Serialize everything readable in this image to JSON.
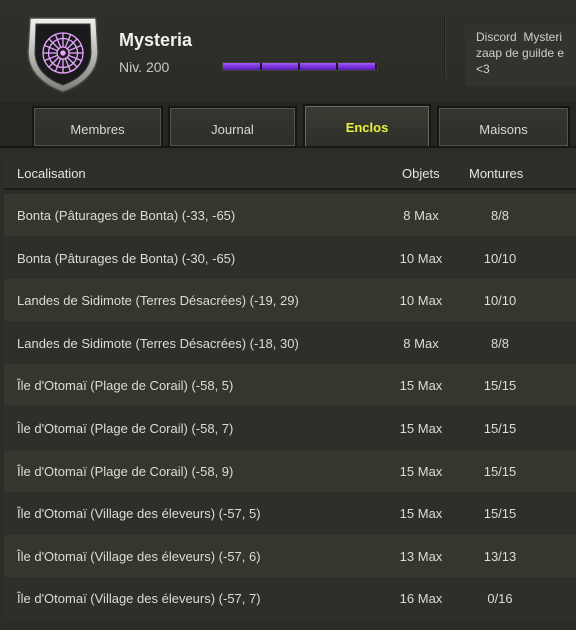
{
  "guild": {
    "name": "Mysteria",
    "level": "Niv. 200",
    "xp_progress": 0.985,
    "emblem_icon": "rose-compass-emblem-icon",
    "emblem_color": "#e8a6ff",
    "message": "Discord  Mysteri\nzaap de guilde e\n<3"
  },
  "tabs": [
    {
      "label": "Membres",
      "active": false
    },
    {
      "label": "Journal",
      "active": false
    },
    {
      "label": "Enclos",
      "active": true
    },
    {
      "label": "Maisons",
      "active": false
    }
  ],
  "table": {
    "headers": {
      "location": "Localisation",
      "objects": "Objets",
      "mounts": "Montures"
    },
    "rows": [
      {
        "location": "Bonta (Pâturages de Bonta) (-33, -65)",
        "objects": "8 Max",
        "mounts": "8/8"
      },
      {
        "location": "Bonta (Pâturages de Bonta) (-30, -65)",
        "objects": "10 Max",
        "mounts": "10/10"
      },
      {
        "location": "Landes de Sidimote (Terres Désacrées) (-19, 29)",
        "objects": "10 Max",
        "mounts": "10/10"
      },
      {
        "location": "Landes de Sidimote (Terres Désacrées) (-18, 30)",
        "objects": "8 Max",
        "mounts": "8/8"
      },
      {
        "location": "Île d'Otomaï (Plage de Corail) (-58, 5)",
        "objects": "15 Max",
        "mounts": "15/15"
      },
      {
        "location": "Île d'Otomaï (Plage de Corail) (-58, 7)",
        "objects": "15 Max",
        "mounts": "15/15"
      },
      {
        "location": "Île d'Otomaï (Plage de Corail) (-58, 9)",
        "objects": "15 Max",
        "mounts": "15/15"
      },
      {
        "location": "Île d'Otomaï (Village des éleveurs) (-57, 5)",
        "objects": "15 Max",
        "mounts": "15/15"
      },
      {
        "location": "Île d'Otomaï (Village des éleveurs) (-57, 6)",
        "objects": "13 Max",
        "mounts": "13/13"
      },
      {
        "location": "Île d'Otomaï (Village des éleveurs) (-57, 7)",
        "objects": "16 Max",
        "mounts": "0/16"
      }
    ]
  },
  "colors": {
    "active_tab_text": "#e8f23a",
    "xp_bar": "#8a3cf0"
  }
}
